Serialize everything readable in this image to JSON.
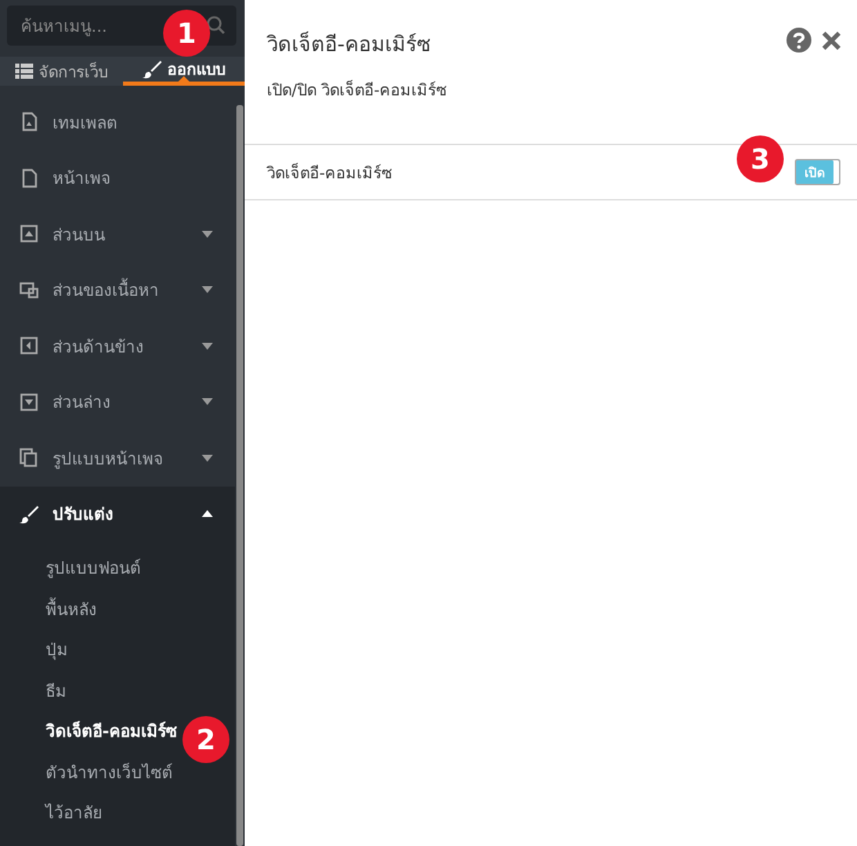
{
  "sidebar": {
    "search": {
      "placeholder": "ค้นหาเมนู..."
    },
    "tabs": [
      {
        "label": "จัดการเว็บ",
        "selected": false
      },
      {
        "label": "ออกแบบ",
        "selected": true
      }
    ],
    "items": [
      {
        "label": "เทมเพลต",
        "expandable": false,
        "expanded": false
      },
      {
        "label": "หน้าเพจ",
        "expandable": false,
        "expanded": false
      },
      {
        "label": "ส่วนบน",
        "expandable": true,
        "expanded": false
      },
      {
        "label": "ส่วนของเนื้อหา",
        "expandable": true,
        "expanded": false
      },
      {
        "label": "ส่วนด้านข้าง",
        "expandable": true,
        "expanded": false
      },
      {
        "label": "ส่วนล่าง",
        "expandable": true,
        "expanded": false
      },
      {
        "label": "รูปแบบหน้าเพจ",
        "expandable": true,
        "expanded": false
      },
      {
        "label": "ปรับแต่ง",
        "expandable": true,
        "expanded": true,
        "children": [
          {
            "label": "รูปแบบฟอนต์",
            "selected": false
          },
          {
            "label": "พื้นหลัง",
            "selected": false
          },
          {
            "label": "ปุ่ม",
            "selected": false
          },
          {
            "label": "ธีม",
            "selected": false
          },
          {
            "label": "วิดเจ็ตอี-คอมเมิร์ซ",
            "selected": true
          },
          {
            "label": "ตัวนำทางเว็บไซต์",
            "selected": false
          },
          {
            "label": "ไว้อาลัย",
            "selected": false
          }
        ]
      }
    ]
  },
  "panel": {
    "title": "วิดเจ็ตอี-คอมเมิร์ซ",
    "subtitle": "เปิด/ปิด วิดเจ็ตอี-คอมเมิร์ซ",
    "settings": [
      {
        "label": "วิดเจ็ตอี-คอมเมิร์ซ",
        "on": true,
        "toggle_label": "เปิด"
      }
    ]
  },
  "callouts": [
    "1",
    "2",
    "3"
  ]
}
